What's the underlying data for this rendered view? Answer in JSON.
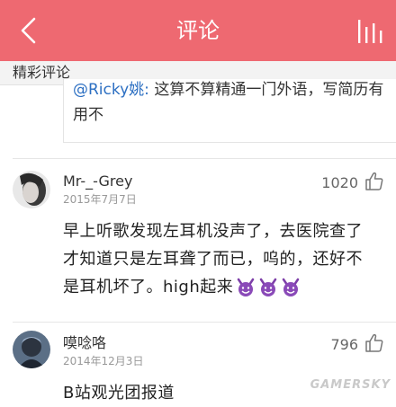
{
  "header": {
    "title": "评论",
    "accent_color": "#ee6971",
    "back_icon": "chevron-left-icon",
    "menu_icon": "bars-icon"
  },
  "section": {
    "title": "精彩评论"
  },
  "quoted": {
    "user": "@Ricky姚:",
    "text": " 这算不算精通一门外语，写简历有用不"
  },
  "comments": [
    {
      "username": "Mr-_-Grey",
      "date": "2015年7月7日",
      "likes": "1020",
      "text": "早上听歌发现左耳机没声了，去医院查了才知道只是左耳聋了而已，呜的，还好不是耳机坏了。high起来",
      "emoji": [
        "smiling-devil-icon",
        "smiling-devil-icon",
        "smiling-devil-icon"
      ]
    },
    {
      "username": "嗼唸咯",
      "date": "2014年12月3日",
      "likes": "796",
      "text": "B站观光团报道"
    }
  ],
  "watermark": "GAMERSKY"
}
